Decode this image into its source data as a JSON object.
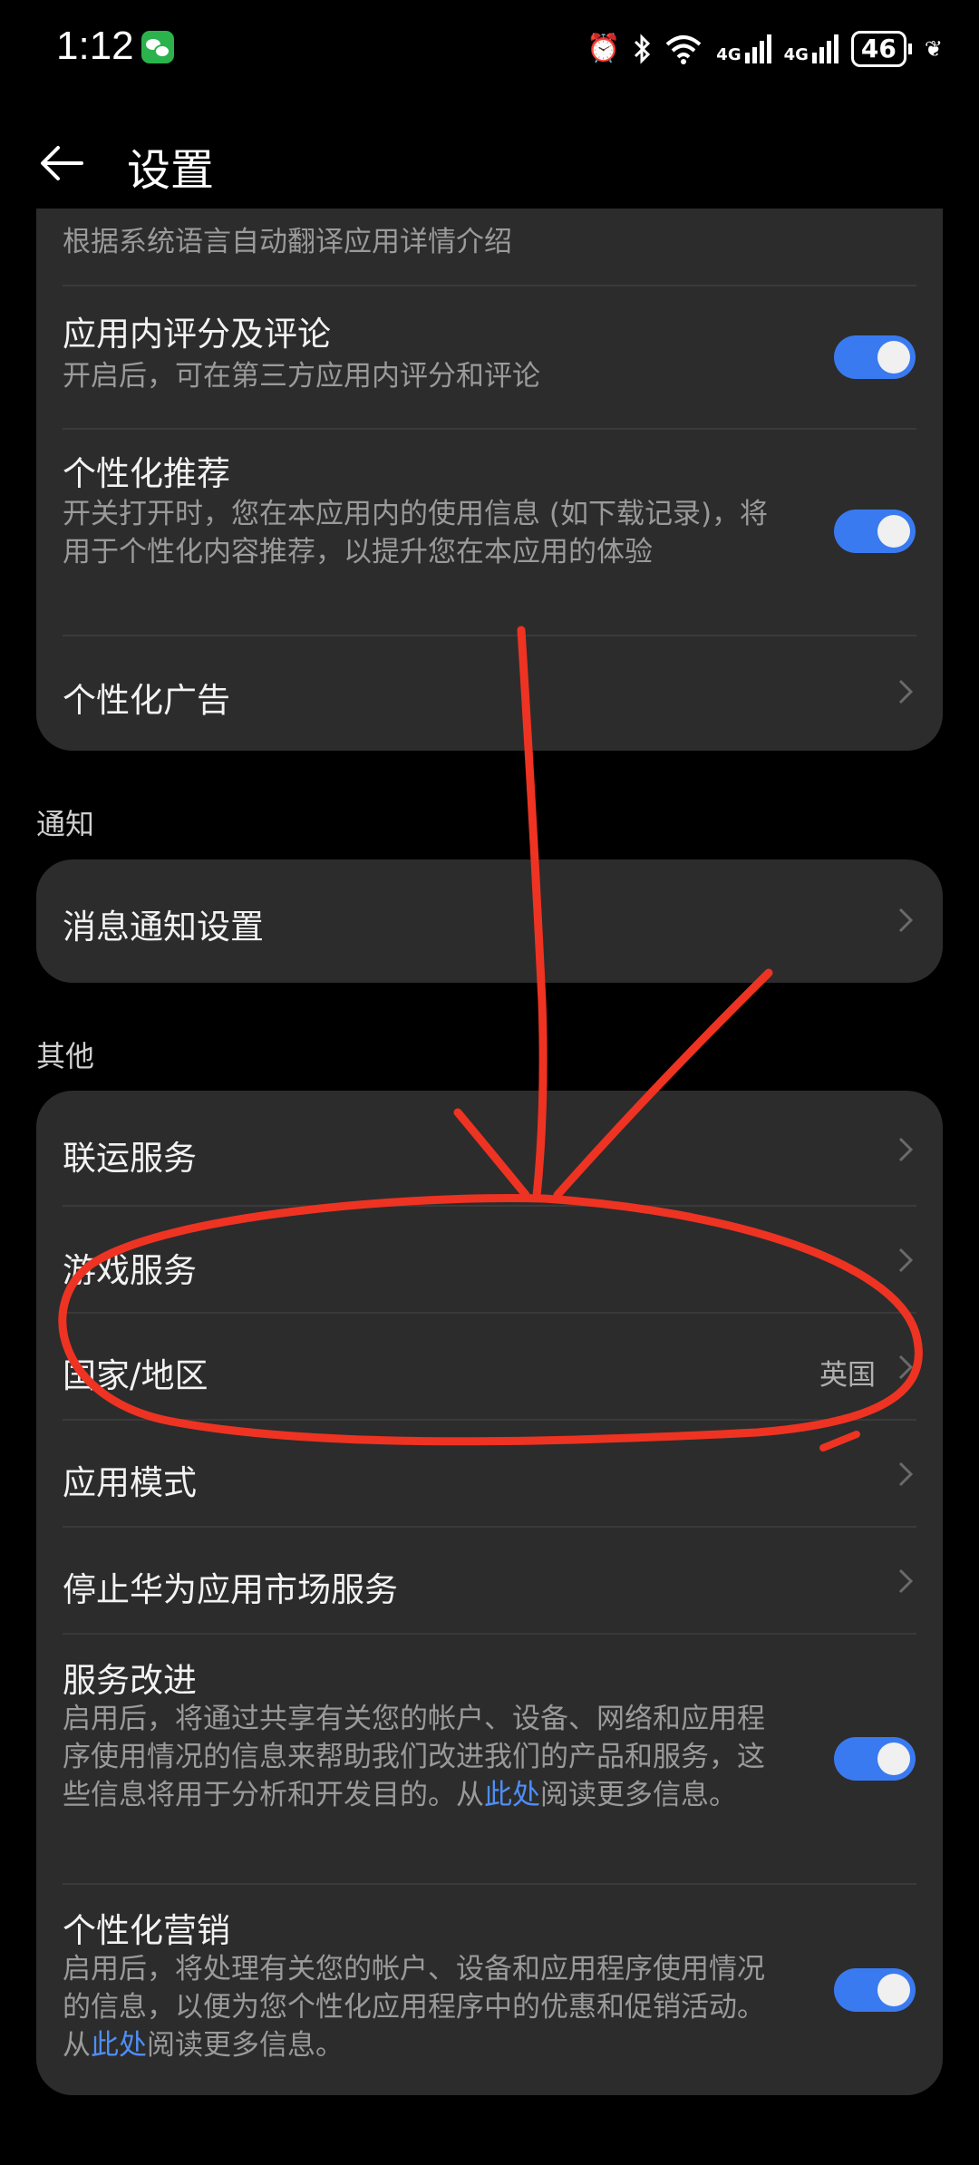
{
  "status_bar": {
    "time": "1:12",
    "network_1": "4G",
    "network_2": "4G",
    "battery": "46"
  },
  "header": {
    "title": "设置"
  },
  "card1": {
    "partial_row_text": "根据系统语言自动翻译应用详情介绍",
    "items": [
      {
        "label": "应用内评分及评论",
        "desc": "开启后，可在第三方应用内评分和评论",
        "toggle": true
      },
      {
        "label": "个性化推荐",
        "desc": "开关打开时，您在本应用内的使用信息 (如下载记录)，将用于个性化内容推荐，以提升您在本应用的体验",
        "toggle": true
      },
      {
        "label": "个性化广告"
      }
    ]
  },
  "section_notify": {
    "title": "通知",
    "item_label": "消息通知设置"
  },
  "section_other": {
    "title": "其他",
    "items": [
      {
        "label": "联运服务"
      },
      {
        "label": "游戏服务"
      },
      {
        "label": "国家/地区",
        "value": "英国"
      },
      {
        "label": "应用模式"
      },
      {
        "label": "停止华为应用市场服务"
      }
    ],
    "service_improve": {
      "label": "服务改进",
      "desc_before": "启用后，将通过共享有关您的帐户、设备、网络和应用程序使用情况的信息来帮助我们改进我们的产品和服务，这些信息将用于分析和开发目的。从",
      "desc_link": "此处",
      "desc_after": "阅读更多信息。",
      "toggle": true
    },
    "personal_marketing": {
      "label": "个性化营销",
      "desc_before": "启用后，将处理有关您的帐户、设备和应用程序使用情况的信息，以便为您个性化应用程序中的优惠和促销活动。从",
      "desc_link": "此处",
      "desc_after": "阅读更多信息。",
      "toggle": true
    }
  },
  "colors": {
    "accent": "#3a7af0",
    "annotation": "#ee3322",
    "card_bg": "#2c2c2c"
  }
}
